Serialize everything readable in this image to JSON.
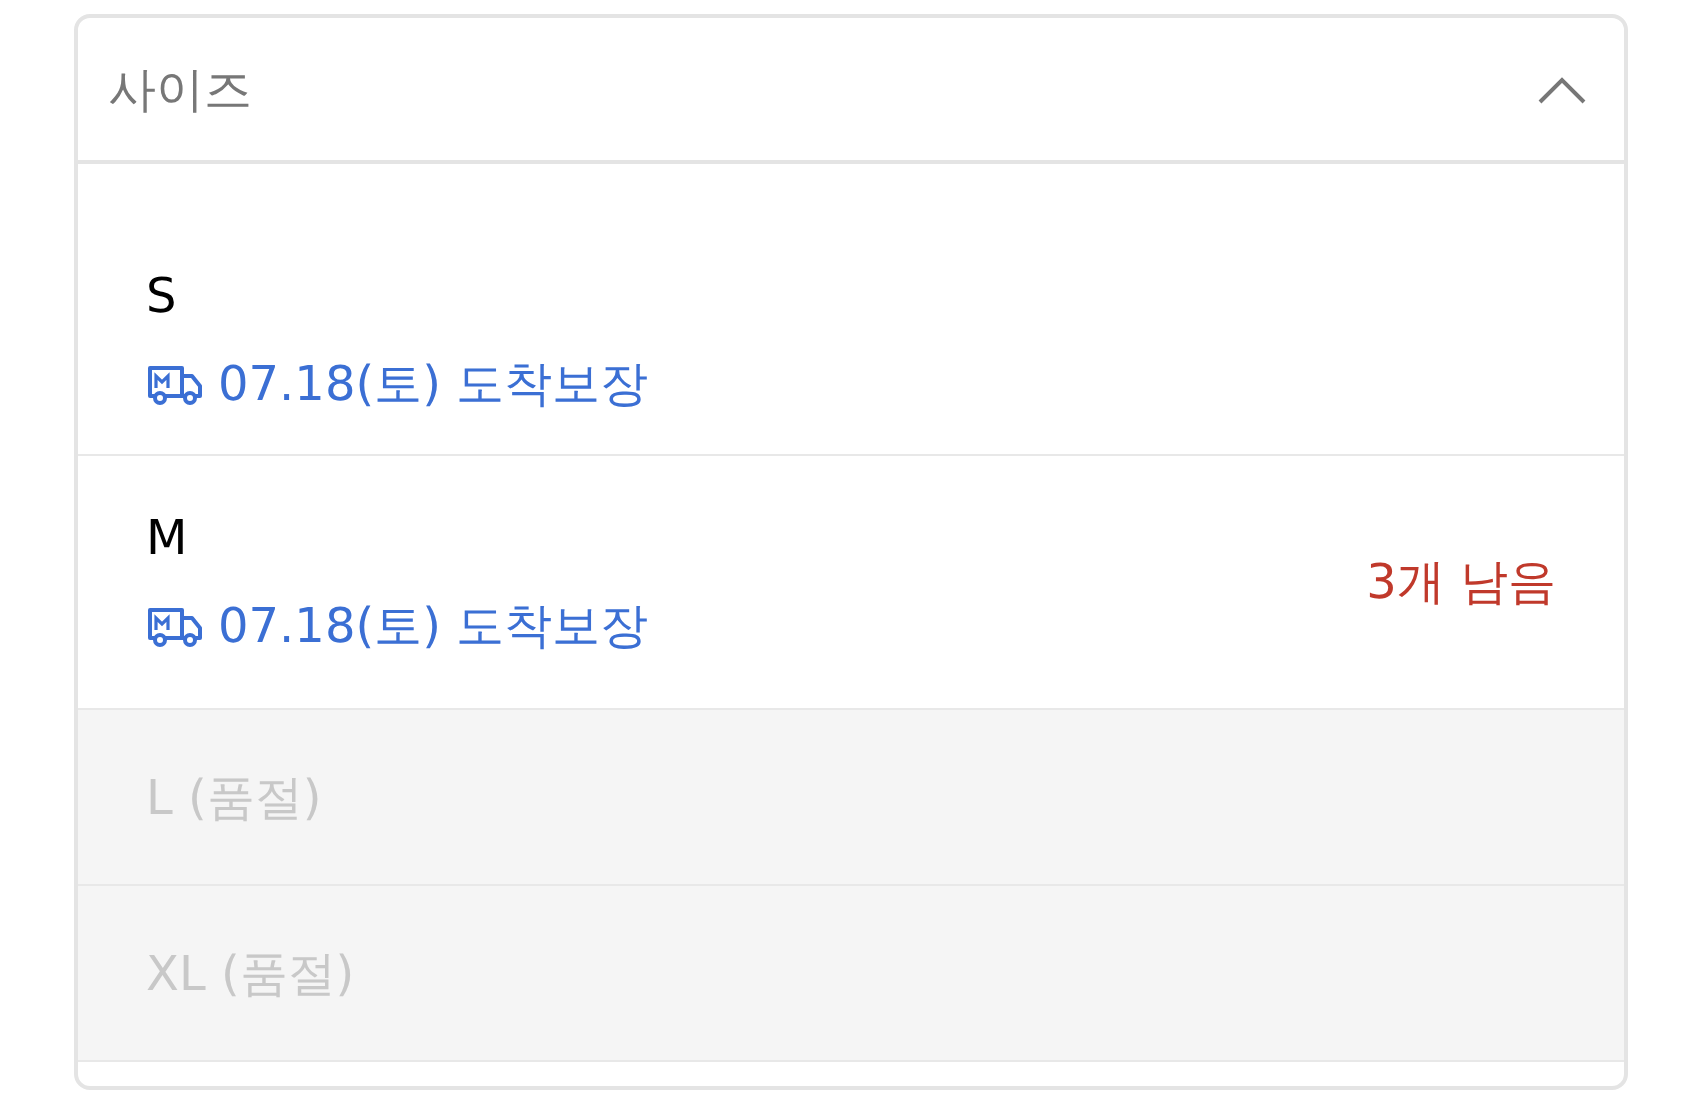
{
  "dropdown": {
    "label": "사이즈",
    "expanded": true,
    "options": [
      {
        "name": "S",
        "disabled": false,
        "delivery": "07.18(토) 도착보장"
      },
      {
        "name": "M",
        "disabled": false,
        "delivery": "07.18(토) 도착보장",
        "stock_note": "3개 남음"
      },
      {
        "name": "L (품절)",
        "disabled": true
      },
      {
        "name": "XL (품절)",
        "disabled": true
      }
    ]
  }
}
